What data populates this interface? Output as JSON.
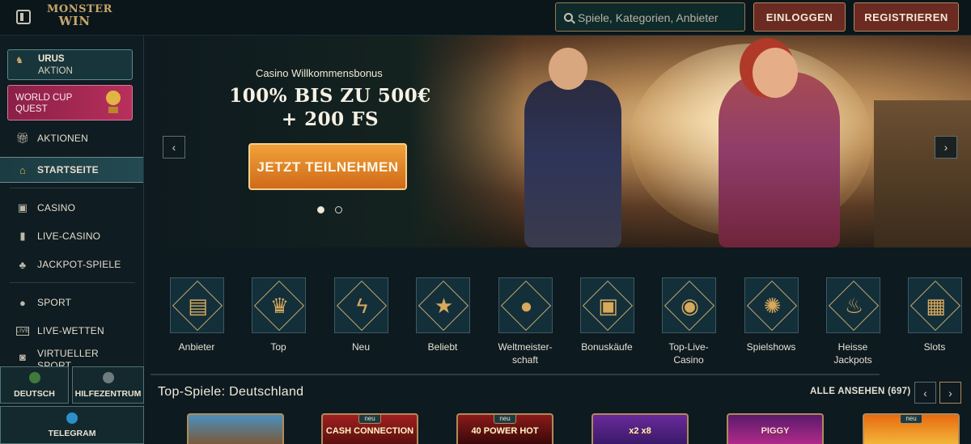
{
  "header": {
    "logo_line1": "MONSTER",
    "logo_line2": "WIN",
    "search_placeholder": "Spiele, Kategorien, Anbieter",
    "login_label": "EINLOGGEN",
    "register_label": "REGISTRIEREN"
  },
  "sidebar": {
    "promo_urus": {
      "title": "URUS",
      "subtitle": "AKTION"
    },
    "promo_worldcup": {
      "label": "WORLD CUP QUEST"
    },
    "items": [
      {
        "label": "AKTIONEN",
        "icon": "gift-icon"
      },
      {
        "label": "STARTSEITE",
        "icon": "home-icon",
        "active": true
      },
      {
        "label": "CASINO",
        "icon": "slot-machine-icon"
      },
      {
        "label": "LIVE-CASINO",
        "icon": "cards-icon"
      },
      {
        "label": "JACKPOT-SPIELE",
        "icon": "clover-icon"
      },
      {
        "label": "SPORT",
        "icon": "ball-icon"
      },
      {
        "label": "LIVE-WETTEN",
        "icon": "live-icon"
      },
      {
        "label": "VIRTUELLER SPORT",
        "icon": "virtual-icon"
      }
    ],
    "bottom": {
      "language": "DEUTSCH",
      "help": "HILFEZENTRUM",
      "telegram": "TELEGRAM"
    }
  },
  "banner": {
    "subtitle": "Casino Willkommensbonus",
    "title": "100% BIS ZU 500€ + 200 FS",
    "cta": "JETZT TEILNEHMEN",
    "active_slide": 1,
    "slide_count": 2
  },
  "categories": [
    {
      "label": "Anbieter",
      "icon": "book-icon"
    },
    {
      "label": "Top",
      "icon": "crown-icon"
    },
    {
      "label": "Neu",
      "icon": "lightning-icon"
    },
    {
      "label": "Beliebt",
      "icon": "star-icon"
    },
    {
      "label": "Weltmeister-schaft",
      "icon": "football-icon"
    },
    {
      "label": "Bonuskäufe",
      "icon": "chest-icon"
    },
    {
      "label": "Top-Live-Casino",
      "icon": "chip-icon"
    },
    {
      "label": "Spielshows",
      "icon": "wheel-icon"
    },
    {
      "label": "Heisse Jackpots",
      "icon": "flame-icon"
    },
    {
      "label": "Slots",
      "icon": "slot-icon"
    }
  ],
  "top_games": {
    "title": "Top-Spiele: Deutschland",
    "see_all": "ALLE ANSEHEN (697)",
    "games": [
      {
        "name": "",
        "tag": ""
      },
      {
        "name": "CASH CONNECTION",
        "tag": "neu"
      },
      {
        "name": "40 POWER HOT",
        "tag": "neu"
      },
      {
        "name": "x2 x8",
        "tag": ""
      },
      {
        "name": "PIGGY",
        "tag": ""
      },
      {
        "name": "",
        "tag": "neu"
      }
    ]
  },
  "colors": {
    "background": "#0d1a20",
    "accent_gold": "#c9a66b",
    "button_red": "#6b2a22",
    "cta_orange": "#e8862a",
    "promo_pink": "#b8305c"
  }
}
